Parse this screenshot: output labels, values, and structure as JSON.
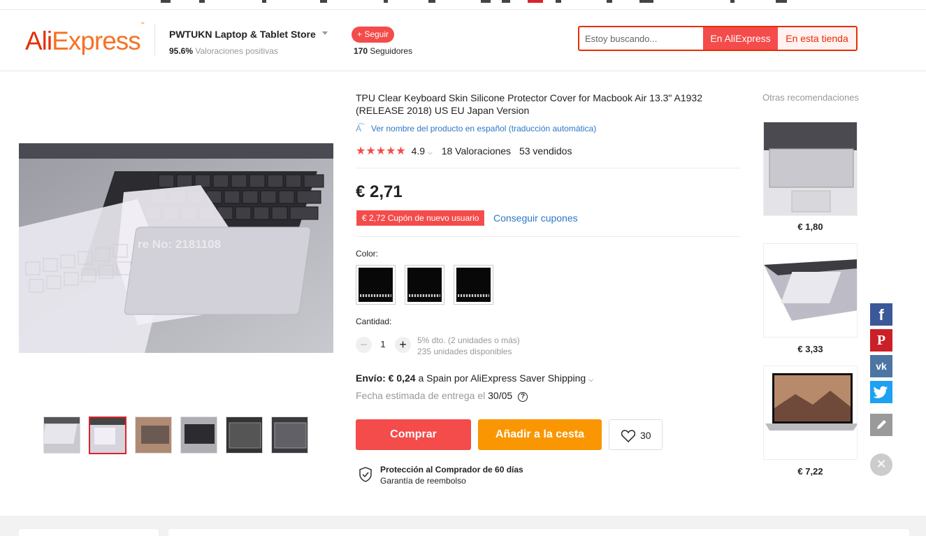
{
  "header": {
    "logo_text": "AliExpress",
    "store": {
      "name": "PWTUKN Laptop & Tablet Store",
      "rating_value": "95.6%",
      "rating_label": "Valoraciones positivas"
    },
    "follow_label": "+ Seguir",
    "followers_count": "170",
    "followers_label": "Seguidores",
    "search": {
      "placeholder": "Estoy buscando...",
      "btn_all": "En AliExpress",
      "btn_store": "En esta tienda"
    }
  },
  "product": {
    "title": "TPU Clear Keyboard Skin Silicone Protector Cover for Macbook Air 13.3\" A1932 (RELEASE 2018) US EU Japan Version",
    "translate_label": "Ver nombre del producto en español (traducción automática)",
    "stars": "★★★★★",
    "rating": "4.9",
    "reviews": "18 Valoraciones",
    "sold": "53 vendidos",
    "price": "€ 2,71",
    "coupon": "€ 2,72 Cupón de nuevo usuario",
    "get_coupons": "Conseguir cupones",
    "color_label": "Color:",
    "quantity_label": "Cantidad:",
    "quantity": "1",
    "discount_note": "5% dto. (2 unidades o más)",
    "stock_note": "235 unidades disponibles",
    "shipping_prefix": "Envío:",
    "shipping_price": "€ 0,24",
    "shipping_rest": "a Spain por AliExpress Saver Shipping",
    "delivery_label": "Fecha estimada de entrega el",
    "delivery_date": "30/05",
    "buy_label": "Comprar",
    "cart_label": "Añadir a la cesta",
    "wish_count": "30",
    "protection_title": "Protección al Comprador de 60 días",
    "protection_sub": "Garantía de reembolso",
    "watermark_text": "re No: 2181108"
  },
  "recommendations": {
    "title": "Otras recomendaciones",
    "items": [
      {
        "price": "€ 1,80"
      },
      {
        "price": "€ 3,33"
      },
      {
        "price": "€ 7,22"
      }
    ]
  },
  "social": {
    "facebook": "f",
    "pinterest": "P",
    "vk": "vk",
    "colors": {
      "facebook": "#3b5998",
      "pinterest": "#cb2027",
      "vk": "#4c75a3",
      "twitter": "#1da1f2",
      "edit": "#9a9a9a"
    }
  },
  "colors": {
    "brand_red": "#f44b4b",
    "brand_orange": "#fa9602",
    "link_blue": "#2c77c7"
  }
}
